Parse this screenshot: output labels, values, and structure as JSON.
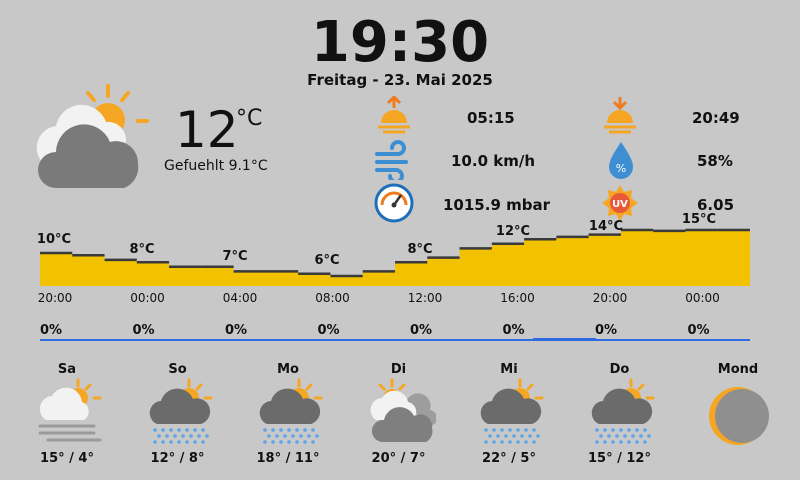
{
  "clock": {
    "time": "19:30",
    "date": "Freitag - 23. Mai 2025"
  },
  "current": {
    "icon": "partly-cloudy-icon",
    "temp": "12",
    "unit": "°C",
    "feels": "Gefuehlt 9.1°C"
  },
  "stats": {
    "sunrise": {
      "icon": "sunrise-icon",
      "value": "05:15"
    },
    "sunset": {
      "icon": "sunset-icon",
      "value": "20:49"
    },
    "wind": {
      "icon": "wind-icon",
      "value": "10.0 km/h"
    },
    "humidity": {
      "icon": "humidity-drop-icon",
      "value": "58%"
    },
    "pressure": {
      "icon": "barometer-icon",
      "value": "1015.9 mbar"
    },
    "uv": {
      "icon": "uv-index-icon",
      "value": "6.05"
    }
  },
  "chart_data": {
    "type": "area",
    "title": "",
    "xlabel": "",
    "ylabel": "",
    "time_ticks": [
      "20:00",
      "00:00",
      "04:00",
      "08:00",
      "12:00",
      "16:00",
      "20:00",
      "00:00"
    ],
    "temperature_values": [
      10,
      9.5,
      8.5,
      8,
      7,
      7,
      6,
      6,
      5.5,
      5,
      6,
      8,
      9,
      11,
      12,
      13,
      13.5,
      14,
      15,
      14.8,
      15,
      15
    ],
    "temperature_labels": [
      "10°C",
      "8°C",
      "7°C",
      "6°C",
      "8°C",
      "12°C",
      "14°C",
      "15°C"
    ],
    "precip_labels": [
      "0%",
      "0%",
      "0%",
      "0%",
      "0%",
      "0%",
      "0%",
      "0%"
    ],
    "colors": {
      "fill": "#f2c200",
      "line": "#3a3a3a",
      "precip": "#2f6be0"
    }
  },
  "forecast": [
    {
      "day": "Sa",
      "icon": "fog-sun-icon",
      "range": "15° / 4°"
    },
    {
      "day": "So",
      "icon": "snow-sun-icon",
      "range": "12° / 8°"
    },
    {
      "day": "Mo",
      "icon": "snow-sun-icon",
      "range": "18° / 11°"
    },
    {
      "day": "Di",
      "icon": "cloudy-sun-icon",
      "range": "20° / 7°"
    },
    {
      "day": "Mi",
      "icon": "snow-sun-icon",
      "range": "22° / 5°"
    },
    {
      "day": "Do",
      "icon": "snow-sun-icon",
      "range": "15° / 12°"
    }
  ],
  "moon": {
    "label": "Mond",
    "icon": "moon-phase-icon"
  }
}
